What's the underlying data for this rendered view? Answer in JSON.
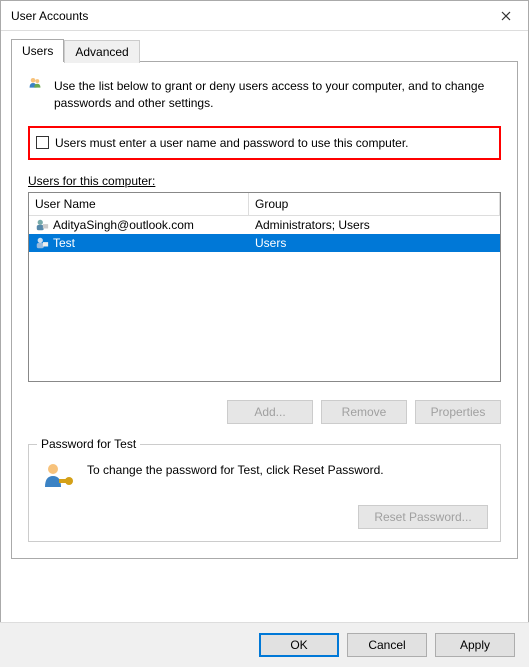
{
  "window": {
    "title": "User Accounts"
  },
  "tabs": {
    "users": "Users",
    "advanced": "Advanced"
  },
  "intro": "Use the list below to grant or deny users access to your computer, and to change passwords and other settings.",
  "checkbox_label": "Users must enter a user name and password to use this computer.",
  "users_section_label": "Users for this computer:",
  "columns": {
    "name": "User Name",
    "group": "Group"
  },
  "rows": [
    {
      "name": "AdityaSingh@outlook.com",
      "group": "Administrators; Users",
      "selected": false
    },
    {
      "name": "Test",
      "group": "Users",
      "selected": true
    }
  ],
  "buttons": {
    "add": "Add...",
    "remove": "Remove",
    "properties": "Properties"
  },
  "password_group": {
    "legend": "Password for Test",
    "text": "To change the password for Test, click Reset Password.",
    "reset": "Reset Password..."
  },
  "dialog_buttons": {
    "ok": "OK",
    "cancel": "Cancel",
    "apply": "Apply"
  }
}
